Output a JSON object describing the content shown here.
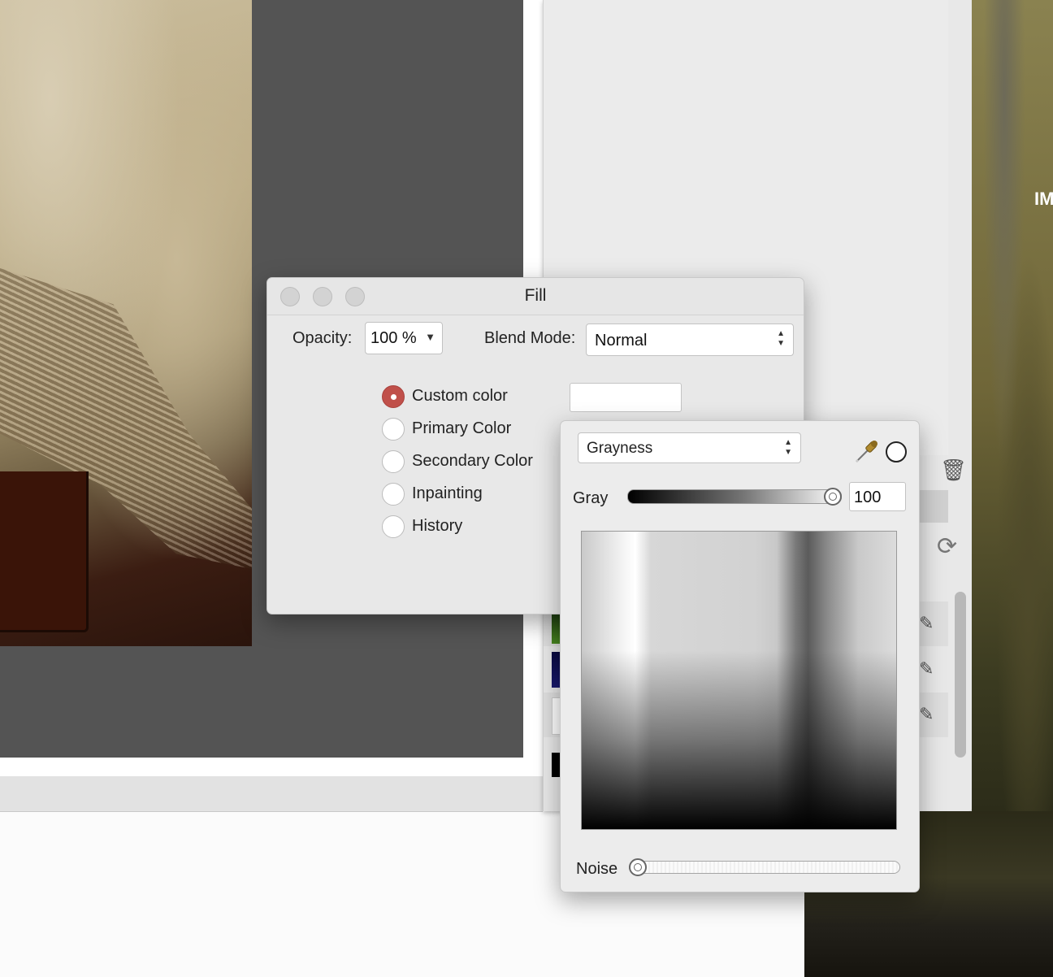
{
  "fill_dialog": {
    "title": "Fill",
    "opacity_label": "Opacity:",
    "opacity_value": "100 %",
    "blend_mode_label": "Blend Mode:",
    "blend_mode_value": "Normal",
    "options": [
      {
        "label": "Custom color",
        "selected": true
      },
      {
        "label": "Primary Color",
        "selected": false
      },
      {
        "label": "Secondary Color",
        "selected": false
      },
      {
        "label": "Inpainting",
        "selected": false
      },
      {
        "label": "History",
        "selected": false
      }
    ],
    "custom_color_hex": "#ffffff"
  },
  "color_picker": {
    "mode_value": "Grayness",
    "gray_label": "Gray",
    "gray_value": "100",
    "noise_label": "Noise",
    "gray_slider_level": 1.0,
    "noise_slider_level": 0.0
  },
  "background": {
    "far_right_text": "IM"
  },
  "colors": {
    "selected_radio": "#c0504a",
    "canvas_gray": "#545454",
    "dialog_bg": "#e8e8e8"
  },
  "icons": [
    "eyedropper-icon",
    "trash-icon",
    "refresh-icon",
    "pencil-icon",
    "chevron-down-icon",
    "up-down-arrows-icon"
  ]
}
